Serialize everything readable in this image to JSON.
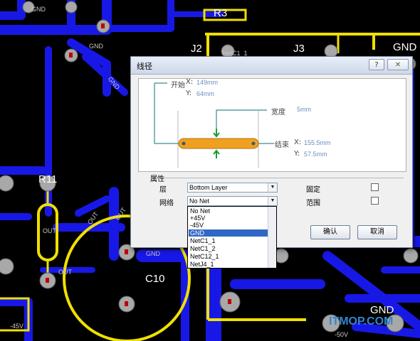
{
  "pcb": {
    "designators": [
      "R3",
      "J2",
      "J3",
      "R11",
      "C10"
    ],
    "net_labels": [
      "GND",
      "GND",
      "GND",
      "GND",
      "GND",
      "GND",
      "OUT",
      "OUT",
      "OUT",
      "OUT",
      "NetC1_1",
      "-45V",
      "-50V"
    ],
    "watermark": "ITMOP.COM",
    "colors": {
      "copper_bottom": "#1414e6",
      "silkscreen": "#f0e000",
      "pad": "#a0a0a0",
      "background": "#000000"
    }
  },
  "dialog": {
    "title": "线径",
    "help_label": "?",
    "close_label": "✕",
    "preview": {
      "start_label": "开始",
      "start_x_label": "X:",
      "start_x": "149mm",
      "start_y_label": "Y:",
      "start_y": "64mm",
      "width_label": "宽度",
      "width_value": "5mm",
      "end_label": "结束",
      "end_x_label": "X:",
      "end_x": "155.5mm",
      "end_y_label": "Y:",
      "end_y": "57.5mm",
      "trace_color": "#f0a020"
    },
    "properties": {
      "group_label": "属性",
      "layer_label": "层",
      "layer_value": "Bottom Layer",
      "net_label": "网络",
      "net_value": "No Net",
      "fixed_label": "固定",
      "range_label": "范围"
    },
    "ok_label": "确认",
    "cancel_label": "取消",
    "net_options": [
      "No Net",
      "+45V",
      "-45V",
      "GND",
      "NetC1_1",
      "NetC1_2",
      "NetC12_1",
      "NetJ4_1"
    ],
    "selected_net": "GND"
  }
}
